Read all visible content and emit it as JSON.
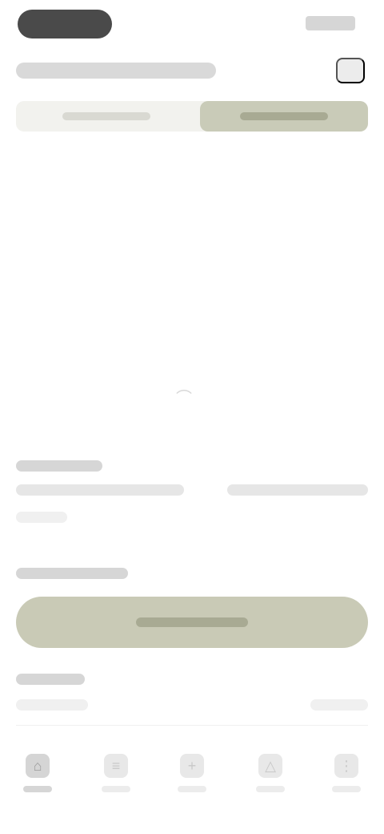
{
  "status_bar": {
    "icons": [
      "status-pill",
      "battery-icon"
    ]
  },
  "header": {
    "title": "",
    "action_icon": "grid-icon"
  },
  "segments": [
    {
      "label": "",
      "active": false
    },
    {
      "label": "",
      "active": true
    }
  ],
  "canvas": {
    "center_icon": "loading-icon"
  },
  "colors": {
    "accent": "#c9cab6",
    "accent_text": "#8e9079",
    "skeleton": "#e6e6e6"
  },
  "primary_button": {
    "label": ""
  },
  "tabbar": {
    "tabs": [
      {
        "icon": "home-icon",
        "active": true
      },
      {
        "icon": "list-icon",
        "active": false
      },
      {
        "icon": "plus-icon",
        "active": false
      },
      {
        "icon": "chart-icon",
        "active": false
      },
      {
        "icon": "menu-icon",
        "active": false
      }
    ]
  }
}
